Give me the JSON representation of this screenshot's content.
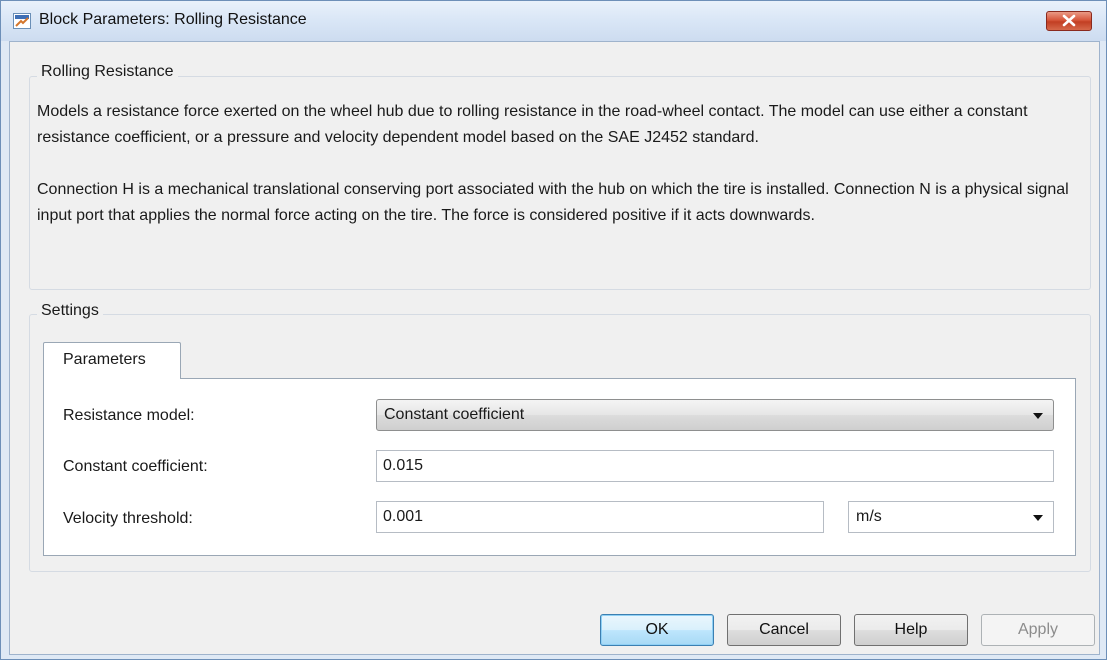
{
  "window": {
    "title": "Block Parameters: Rolling Resistance",
    "icon": "simulink-block-icon",
    "close_icon": "close-icon"
  },
  "description_group": {
    "legend": "Rolling Resistance",
    "paragraph1": "Models a resistance force exerted on the wheel hub due to rolling resistance in the road-wheel contact. The model can use either a constant resistance coefficient, or a pressure and velocity dependent model based on the SAE J2452 standard.",
    "paragraph2": "Connection H is a mechanical translational conserving port associated with the hub on which the tire is installed. Connection N is a physical signal input port that applies the normal force acting on the tire. The force is considered positive if it acts downwards."
  },
  "settings_group": {
    "legend": "Settings",
    "tabs": [
      {
        "label": "Parameters",
        "selected": true
      }
    ],
    "parameters": {
      "resistance_model": {
        "label": "Resistance model:",
        "value": "Constant coefficient"
      },
      "constant_coefficient": {
        "label": "Constant coefficient:",
        "value": "0.015"
      },
      "velocity_threshold": {
        "label": "Velocity threshold:",
        "value": "0.001",
        "unit": "m/s"
      }
    }
  },
  "buttons": {
    "ok": "OK",
    "cancel": "Cancel",
    "help": "Help",
    "apply": "Apply"
  },
  "colors": {
    "window_frame": "#dfe9f5",
    "dialog_background": "#f0f0f0",
    "close_button": "#c94a30",
    "default_button_border": "#3c7fb1"
  }
}
